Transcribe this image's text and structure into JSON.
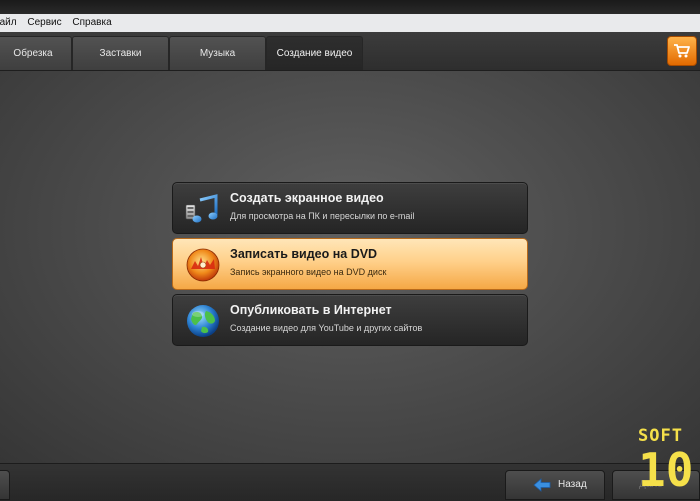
{
  "menu": [
    "Файл",
    "Сервис",
    "Справка"
  ],
  "tabs": [
    {
      "label": "Обрезка"
    },
    {
      "label": "Заставки"
    },
    {
      "label": "Музыка"
    },
    {
      "label": "Создание видео"
    }
  ],
  "active_tab": "Создание видео",
  "options": [
    {
      "title": "Создать экранное видео",
      "subtitle": "Для просмотра на ПК и пересылки по e-mail",
      "icon": "music-notes-icon"
    },
    {
      "title": "Записать видео на DVD",
      "subtitle": "Запись экранного видео на DVD диск",
      "icon": "dvd-disc-icon"
    },
    {
      "title": "Опубликовать в Интернет",
      "subtitle": "Создание видео для YouTube и других сайтов",
      "icon": "globe-icon"
    }
  ],
  "footer": {
    "back_label": "Назад",
    "next_label": "Дале"
  },
  "watermark": {
    "line1": "SOFT",
    "line2": "10"
  },
  "colors": {
    "accent_orange": "#f5a845",
    "cart_orange": "#e26a00",
    "back_arrow_blue": "#3a8fe0",
    "watermark_yellow": "#f5e04a"
  }
}
